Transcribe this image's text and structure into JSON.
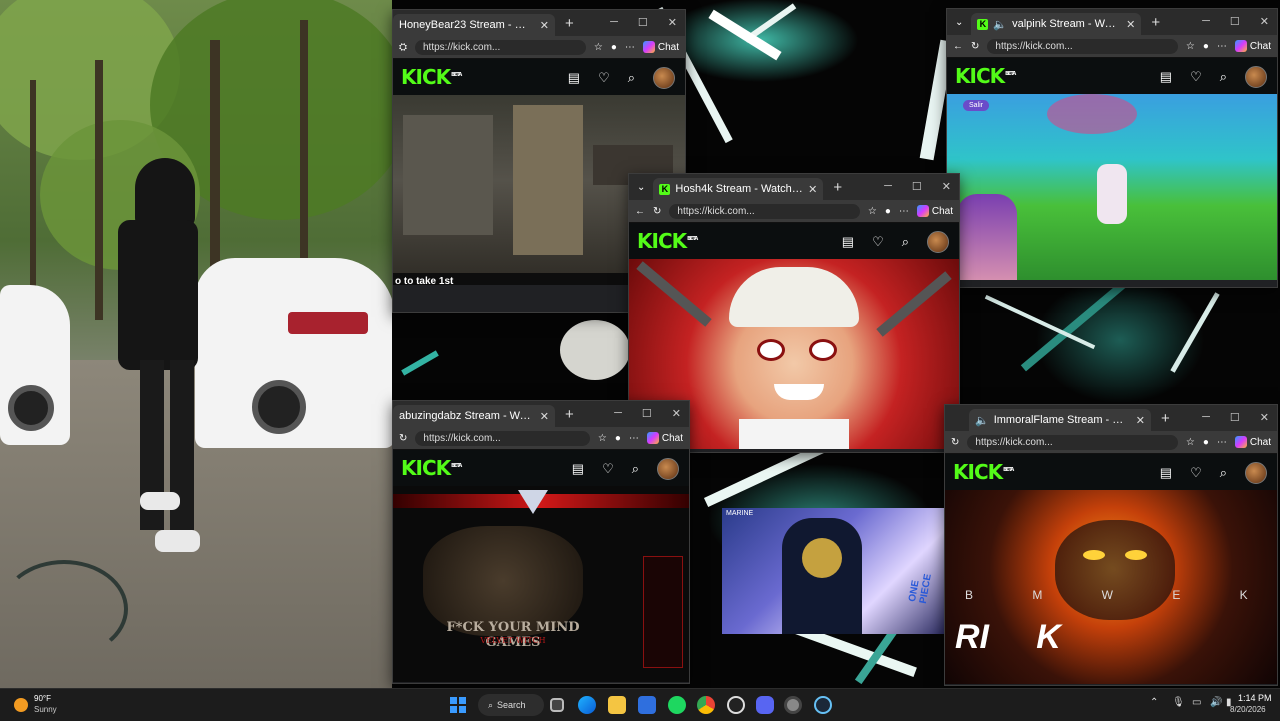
{
  "windows": {
    "honeybear": {
      "tab_title": "HoneyBear23 Stream - Watch Live",
      "url": "https://kick.com...",
      "chat_label": "Chat",
      "caption": "o to take 1st"
    },
    "hosh4k": {
      "tab_title": "Hosh4k Stream - Watch Live on K",
      "url": "https://kick.com...",
      "chat_label": "Chat"
    },
    "valpink": {
      "tab_title": "valpink Stream - Watch Live o",
      "url": "https://kick.com...",
      "chat_label": "Chat",
      "overlay_tag": "Salir"
    },
    "abuzing": {
      "tab_title": "abuzingdabz Stream - Watch Live",
      "url": "https://kick.com...",
      "chat_label": "Chat",
      "art_text": "F*CK YOUR MIND GAMES",
      "art_subtext": "VELVET WITCH"
    },
    "immoral": {
      "tab_title": "ImmoralFlame Stream - Watch",
      "url": "https://kick.com...",
      "chat_label": "Chat",
      "art_letters_top": "B M W E K",
      "art_letters_bottom": "RI     K"
    }
  },
  "kick": {
    "logo": "KICK",
    "beta": "BETA"
  },
  "webcam_overlay": {
    "label": "MARINE",
    "label2": "ONE PIECE"
  },
  "taskbar": {
    "weather_temp": "90°F",
    "weather_desc": "Sunny",
    "search_label": "Search",
    "time": "1:14 PM",
    "date": "8/20/2026",
    "icons": [
      "windows-icon",
      "search-icon",
      "task-view-icon",
      "edge-icon",
      "file-explorer-icon",
      "store-icon",
      "spotify-icon",
      "chrome-icon",
      "app-icon",
      "discord-icon",
      "settings-icon",
      "steam-icon"
    ]
  },
  "colors": {
    "kick_green": "#53fc18",
    "taskbar": "#1c1c1c",
    "chrome_tab": "#2b2b2b"
  }
}
